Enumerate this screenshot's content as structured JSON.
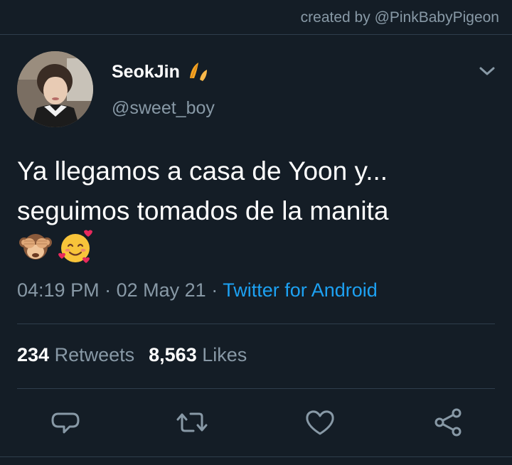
{
  "watermark": "created by @PinkBabyPigeon",
  "tweet": {
    "display_name": "SeokJin",
    "handle": "@sweet_boy",
    "text_line1": "Ya llegamos a casa de Yoon y...",
    "text_line2": "seguimos tomados de la manita",
    "emojis": [
      "see-no-evil-monkey",
      "smiling-face-with-hearts"
    ],
    "time": "04:19 PM",
    "date": "02 May 21",
    "separator": "·",
    "source": "Twitter for Android",
    "retweets_count": "234",
    "retweets_label": "Retweets",
    "likes_count": "8,563",
    "likes_label": "Likes"
  },
  "icons": {
    "name_badge": "leaf-icon",
    "menu": "chevron-down-icon",
    "reply": "reply-icon",
    "retweet": "retweet-icon",
    "like": "heart-icon",
    "share": "share-icon"
  },
  "colors": {
    "background": "#141d26",
    "secondary_text": "#8899a6",
    "link": "#1da1f2",
    "divider": "#2f3e4c"
  }
}
